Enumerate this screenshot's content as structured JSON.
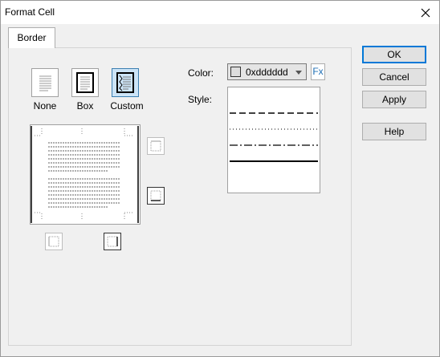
{
  "window": {
    "title": "Format Cell"
  },
  "tabs": [
    {
      "label": "Border"
    }
  ],
  "presets": [
    {
      "label": "None",
      "icon": "border-none-icon"
    },
    {
      "label": "Box",
      "icon": "border-box-icon"
    },
    {
      "label": "Custom",
      "icon": "border-custom-icon",
      "selected": true
    }
  ],
  "color": {
    "label": "Color:",
    "value": "0xdddddd",
    "swatch": "#dddddd",
    "fx_label": "Fx"
  },
  "style": {
    "label": "Style:",
    "options": [
      "none",
      "dashed",
      "dotted",
      "dash-dot",
      "solid-thick"
    ]
  },
  "buttons": {
    "ok": "OK",
    "cancel": "Cancel",
    "apply": "Apply",
    "help": "Help"
  }
}
